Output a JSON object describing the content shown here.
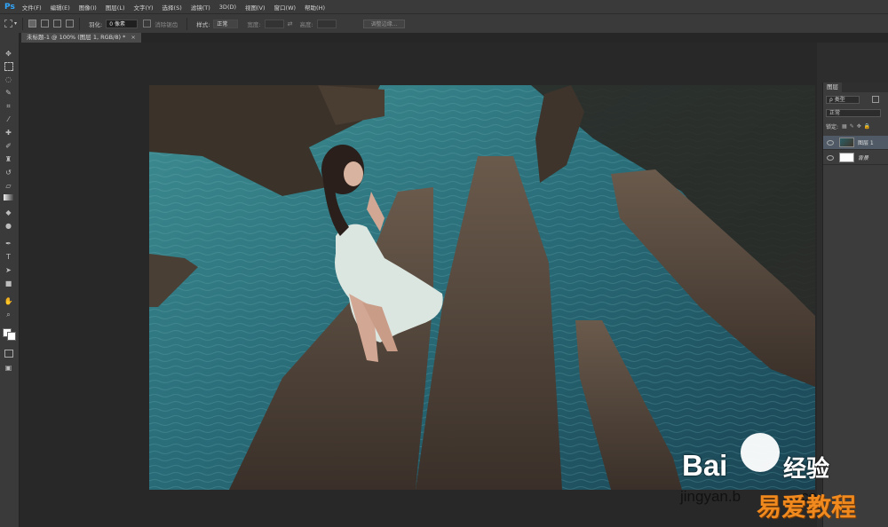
{
  "app": {
    "logo": "Ps"
  },
  "menu": [
    "文件(F)",
    "编辑(E)",
    "图像(I)",
    "图层(L)",
    "文字(Y)",
    "选择(S)",
    "滤镜(T)",
    "3D(D)",
    "视图(V)",
    "窗口(W)",
    "帮助(H)"
  ],
  "options": {
    "feather_label": "羽化:",
    "feather_value": "0 像素",
    "antialias_label": "消除锯齿",
    "style_label": "样式:",
    "style_value": "正常",
    "width_label": "宽度:",
    "height_label": "高度:",
    "refine_button": "调整边缘..."
  },
  "document": {
    "tab_title": "未标题-1 @ 100% (图层 1, RGB/8) *",
    "close": "×"
  },
  "layers_panel": {
    "title": "图层",
    "filter_label": "ρ 类型",
    "blend_mode": "正常",
    "lock_label": "锁定:",
    "layers": [
      {
        "name": "图层 1",
        "selected": true
      },
      {
        "name": "背景",
        "selected": false
      }
    ]
  },
  "watermark": {
    "brand": "Bai",
    "brand2": "经验",
    "url": "jingyan.b",
    "url2": "co",
    "site": "易爱教程"
  },
  "colors": {
    "ui_dark": "#282828",
    "ui_panel": "#3a3a3a",
    "accent": "#31a8ff",
    "watermark_orange": "#f08a1f"
  }
}
